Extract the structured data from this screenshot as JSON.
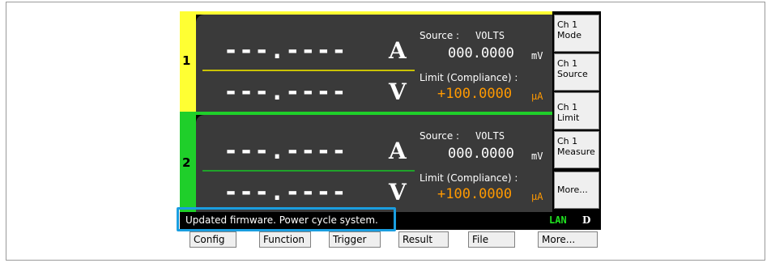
{
  "channels": [
    {
      "number": "1",
      "current_reading": "---.----",
      "current_unit": "A",
      "voltage_reading": "---.----",
      "voltage_unit": "V",
      "source_label": "Source :",
      "source_type": "VOLTS",
      "source_value": "000.0000",
      "source_unit": "mV",
      "limit_label": "Limit (Compliance) :",
      "limit_value": "+100.0000",
      "limit_unit": "µA",
      "color": "#ffff33"
    },
    {
      "number": "2",
      "current_reading": "---.----",
      "current_unit": "A",
      "voltage_reading": "---.----",
      "voltage_unit": "V",
      "source_label": "Source :",
      "source_type": "VOLTS",
      "source_value": "000.0000",
      "source_unit": "mV",
      "limit_label": "Limit (Compliance) :",
      "limit_value": "+100.0000",
      "limit_unit": "µA",
      "color": "#1fcf2a"
    }
  ],
  "softkeys": [
    {
      "line1": "Ch 1",
      "line2": "Mode"
    },
    {
      "line1": "Ch 1",
      "line2": "Source"
    },
    {
      "line1": "Ch 1",
      "line2": "Limit"
    },
    {
      "line1": "Ch 1",
      "line2": "Measure"
    },
    {
      "line1": "More...",
      "line2": ""
    }
  ],
  "status": {
    "message": "Updated firmware.  Power cycle system.",
    "lan": "LAN",
    "flag": "D"
  },
  "tabs": [
    "Config",
    "Function",
    "Trigger",
    "Result",
    "File",
    "More..."
  ],
  "colors": {
    "highlight": "#1a9ee0",
    "limit_value": "#ff9900",
    "lan": "#20e020"
  }
}
